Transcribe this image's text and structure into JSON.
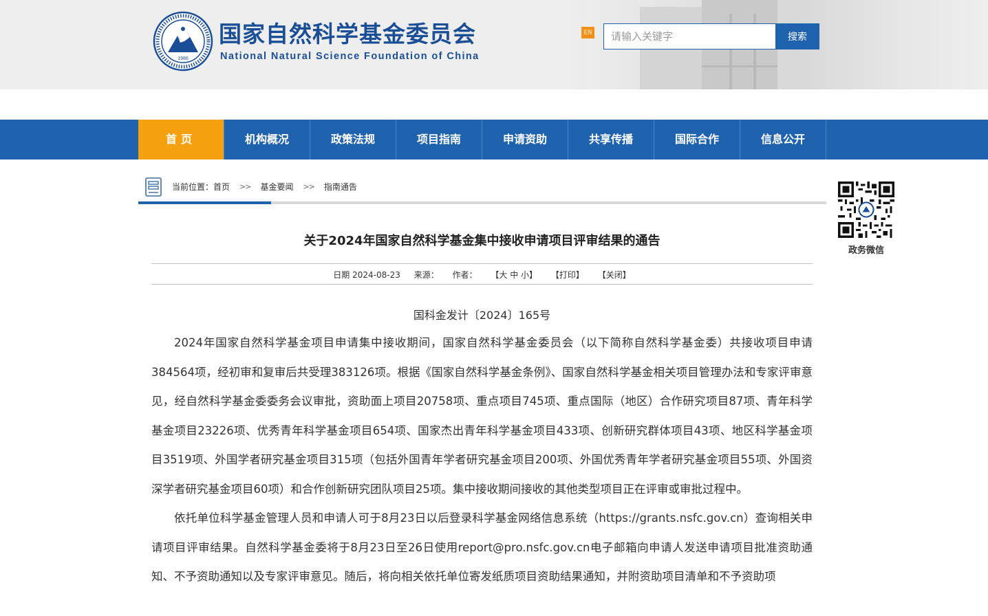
{
  "header": {
    "logo_year": "1986",
    "title_cn": "国家自然科学基金委员会",
    "title_en": "National Natural Science Foundation of China",
    "en_label": "EN",
    "search_placeholder": "请输入关键字",
    "search_button": "搜索"
  },
  "nav": {
    "items": [
      "首页",
      "机构概况",
      "政策法规",
      "项目指南",
      "申请资助",
      "共享传播",
      "国际合作",
      "信息公开"
    ]
  },
  "breadcrumb": {
    "prefix": "当前位置：",
    "items": [
      "首页",
      "基金要闻",
      "指南通告"
    ],
    "separator": ">>"
  },
  "qr": {
    "label": "政务微信"
  },
  "article": {
    "title": "关于2024年国家自然科学基金集中接收申请项目评审结果的通告",
    "meta": {
      "date": "日期 2024-08-23",
      "source": "来源：",
      "author": "作者：",
      "font_size": "【大 中 小】",
      "print": "【打印】",
      "close": "【关闭】"
    },
    "doc_no": "国科金发计〔2024〕165号",
    "paragraphs": [
      "2024年国家自然科学基金项目申请集中接收期间，国家自然科学基金委员会（以下简称自然科学基金委）共接收项目申请384564项，经初审和复审后共受理383126项。根据《国家自然科学基金条例》、国家自然科学基金相关项目管理办法和专家评审意见，经自然科学基金委委务会议审批，资助面上项目20758项、重点项目745项、重点国际（地区）合作研究项目87项、青年科学基金项目23226项、优秀青年科学基金项目654项、国家杰出青年科学基金项目433项、创新研究群体项目43项、地区科学基金项目3519项、外国学者研究基金项目315项（包括外国青年学者研究基金项目200项、外国优秀青年学者研究基金项目55项、外国资深学者研究基金项目60项）和合作创新研究团队项目25项。集中接收期间接收的其他类型项目正在评审或审批过程中。",
      "依托单位科学基金管理人员和申请人可于8月23日以后登录科学基金网络信息系统（https://grants.nsfc.gov.cn）查询相关申请项目评审结果。自然科学基金委将于8月23日至26日使用report@pro.nsfc.gov.cn电子邮箱向申请人发送申请项目批准资助通知、不予资助通知以及专家评审意见。随后，将向相关依托单位寄发纸质项目资助结果通知，并附资助项目清单和不予资助项"
    ]
  },
  "colors": {
    "brand_blue": "#1f62ad",
    "title_blue": "#1a4e96",
    "nav_active": "#f5a00f",
    "en_badge": "#f0921a"
  }
}
